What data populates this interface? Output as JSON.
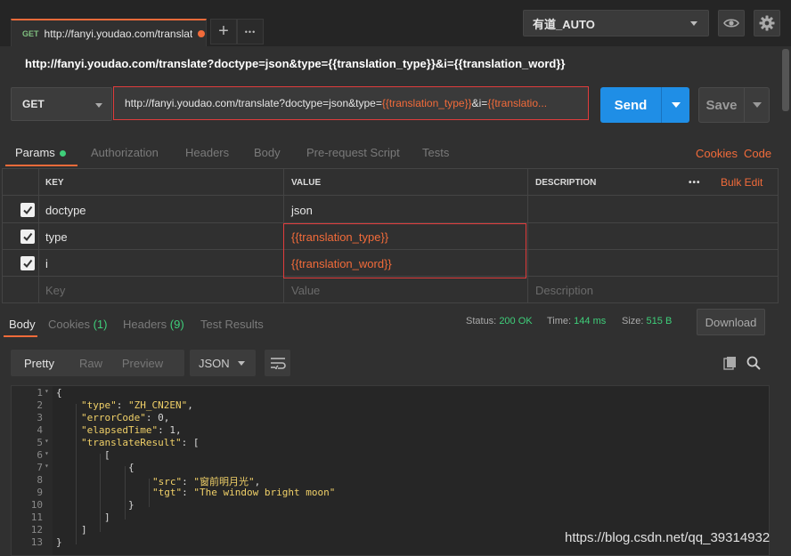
{
  "tab": {
    "method": "GET",
    "title": "http://fanyi.youdao.com/translat",
    "new_tab": "+",
    "more": "•••"
  },
  "environment": {
    "selected": "有道_AUTO"
  },
  "request": {
    "title": "http://fanyi.youdao.com/translate?doctype=json&type={{translation_type}}&i={{translation_word}}",
    "method": "GET",
    "url_prefix": "http://fanyi.youdao.com/translate?doctype=json&type=",
    "url_var1": "{{translation_type}}",
    "url_mid": "&i=",
    "url_var2": "{{translatio...",
    "send": "Send",
    "save": "Save"
  },
  "param_tabs": [
    "Params",
    "Authorization",
    "Headers",
    "Body",
    "Pre-request Script",
    "Tests"
  ],
  "links": {
    "cookies": "Cookies",
    "code": "Code"
  },
  "params": {
    "headers": {
      "key": "KEY",
      "value": "VALUE",
      "description": "DESCRIPTION",
      "more": "•••",
      "bulk_edit": "Bulk Edit"
    },
    "rows": [
      {
        "key": "doctype",
        "value": "json",
        "checked": true
      },
      {
        "key": "type",
        "value": "{{translation_type}}",
        "checked": true
      },
      {
        "key": "i",
        "value": "{{translation_word}}",
        "checked": true
      }
    ],
    "placeholder": {
      "key": "Key",
      "value": "Value",
      "description": "Description"
    }
  },
  "response": {
    "tabs": {
      "body": "Body",
      "cookies": "Cookies",
      "cookies_count": "(1)",
      "headers": "Headers",
      "headers_count": "(9)",
      "tests": "Test Results"
    },
    "status_label": "Status:",
    "status": "200 OK",
    "time_label": "Time:",
    "time": "144 ms",
    "size_label": "Size:",
    "size": "515 B",
    "download": "Download",
    "views": [
      "Pretty",
      "Raw",
      "Preview"
    ],
    "format": "JSON"
  },
  "code_lines": [
    {
      "n": "1",
      "fold": true
    },
    {
      "n": "2"
    },
    {
      "n": "3"
    },
    {
      "n": "4"
    },
    {
      "n": "5",
      "fold": true
    },
    {
      "n": "6",
      "fold": true
    },
    {
      "n": "7",
      "fold": true
    },
    {
      "n": "8"
    },
    {
      "n": "9"
    },
    {
      "n": "10"
    },
    {
      "n": "11"
    },
    {
      "n": "12"
    },
    {
      "n": "13"
    }
  ],
  "code": {
    "l1": "{",
    "l2k": "\"type\"",
    "l2v": "\"ZH_CN2EN\"",
    "l3k": "\"errorCode\"",
    "l3v": "0",
    "l4k": "\"elapsedTime\"",
    "l4v": "1",
    "l5k": "\"translateResult\"",
    "l5v": "[",
    "l6": "[",
    "l7": "{",
    "l8k": "\"src\"",
    "l8v": "\"窗前明月光\"",
    "l9k": "\"tgt\"",
    "l9v": "\"The window bright moon\"",
    "l10": "}",
    "l11": "]",
    "l12": "]",
    "l13": "}"
  },
  "watermark": "https://blog.csdn.net/qq_39314932"
}
